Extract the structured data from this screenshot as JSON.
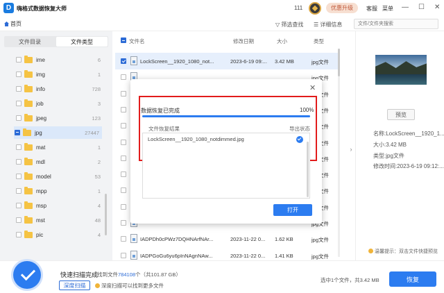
{
  "app": {
    "logo_letter": "D",
    "title": "嗨格式数据恢复大师"
  },
  "titlebar": {
    "count": "111",
    "upgrade_label": "优惠升级",
    "service_label": "客服",
    "menu_label": "菜单",
    "min_glyph": "—",
    "max_glyph": "☐",
    "close_glyph": "✕",
    "medal_icon": "medal-icon"
  },
  "toolbar": {
    "home_label": "首页",
    "filter_label": "筛选查找",
    "details_label": "详细信息",
    "search_placeholder": "文件/文件夹搜索"
  },
  "left": {
    "tabs": [
      "文件目录",
      "文件类型"
    ],
    "active_tab": 1,
    "folders": [
      {
        "name": "ime",
        "count": "6"
      },
      {
        "name": "img",
        "count": "1"
      },
      {
        "name": "info",
        "count": "728"
      },
      {
        "name": "job",
        "count": "3"
      },
      {
        "name": "jpeg",
        "count": "123"
      },
      {
        "name": "jpg",
        "count": "27447",
        "selected": true
      },
      {
        "name": "mat",
        "count": "1"
      },
      {
        "name": "mdl",
        "count": "2"
      },
      {
        "name": "model",
        "count": "53"
      },
      {
        "name": "mpp",
        "count": "1"
      },
      {
        "name": "msp",
        "count": "4"
      },
      {
        "name": "mst",
        "count": "48"
      },
      {
        "name": "pic",
        "count": "4"
      }
    ]
  },
  "filelist": {
    "columns": {
      "name": "文件名",
      "date": "修改日期",
      "size": "大小",
      "type": "类型"
    },
    "rows": [
      {
        "name": "LockScreen__1920_1080_not...",
        "date": "2023-6-19 09:...",
        "size": "3.42 MB",
        "type": "jpg文件",
        "selected": true
      },
      {
        "name": "",
        "date": "",
        "size": "",
        "type": "jpg文件"
      },
      {
        "name": "",
        "date": "",
        "size": "",
        "type": "jpg文件"
      },
      {
        "name": "",
        "date": "",
        "size": "",
        "type": "jpg文件"
      },
      {
        "name": "",
        "date": "",
        "size": "",
        "type": "jpg文件"
      },
      {
        "name": "",
        "date": "",
        "size": "",
        "type": "jpg文件"
      },
      {
        "name": "",
        "date": "",
        "size": "",
        "type": "jpg文件"
      },
      {
        "name": "",
        "date": "",
        "size": "",
        "type": "jpg文件"
      },
      {
        "name": "",
        "date": "",
        "size": "",
        "type": "jpg文件"
      },
      {
        "name": "",
        "date": "",
        "size": "",
        "type": "jpg文件"
      },
      {
        "name": "",
        "date": "",
        "size": "",
        "type": "jpg文件"
      },
      {
        "name": "IADPDh0cPWz7DQHNArfNAr...",
        "date": "2023-11-22 0...",
        "size": "1.62 KB",
        "type": "jpg文件"
      },
      {
        "name": "IADPGoGu6yu6pInNAgnNAw...",
        "date": "2023-11-22 0...",
        "size": "1.41 KB",
        "type": "jpg文件"
      }
    ]
  },
  "preview": {
    "collapse_glyph": "›",
    "button_label": "预览",
    "name": "名称:LockScreen__1920_1...",
    "size": "大小:3.42 MB",
    "type": "类型:jpg文件",
    "modified": "修改时间:2023-6-19 09:12:...",
    "tip": "温馨提示：双击文件快捷预览"
  },
  "bottom": {
    "scan_title": "快速扫描完成",
    "found_prefix": "找到文件",
    "found_count": "784108",
    "found_suffix": "个（共101.87 GB）",
    "deep_scan_label": "深度扫描",
    "deep_tip": "深度扫描可以找到更多文件",
    "selection_info": "选中1个文件，共3.42 MB",
    "recover_label": "恢复"
  },
  "dialog": {
    "close_glyph": "✕",
    "status": "数据恢复已完成",
    "percent_label": "100%",
    "progress_fraction": 1.0,
    "result_header": "文件恢复结果",
    "export_header": "导出状态",
    "result_item": "LockScreen__1920_1080_notdimmed.jpg",
    "open_label": "打开"
  },
  "colors": {
    "accent": "#2c7cf0",
    "highlight": "#e21b1b",
    "folder": "#f5c344"
  }
}
